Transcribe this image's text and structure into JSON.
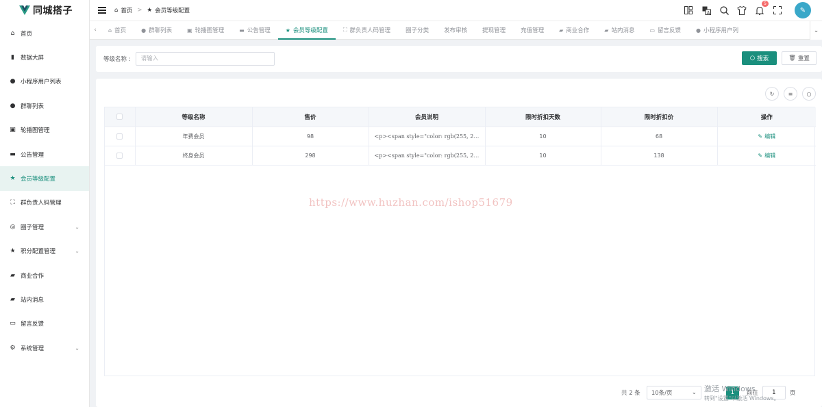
{
  "app": {
    "title": "同城搭子"
  },
  "sidebar": {
    "items": [
      {
        "label": "首页",
        "icon": "home-icon",
        "glyph": "⌂",
        "active": false,
        "expandable": false
      },
      {
        "label": "数据大屏",
        "icon": "bar-chart-icon",
        "glyph": "▮",
        "active": false,
        "expandable": false
      },
      {
        "label": "小程序用户列表",
        "icon": "user-icon",
        "glyph": "●",
        "active": false,
        "expandable": false
      },
      {
        "label": "群聊列表",
        "icon": "user-icon",
        "glyph": "●",
        "active": false,
        "expandable": false
      },
      {
        "label": "轮播图管理",
        "icon": "image-icon",
        "glyph": "▣",
        "active": false,
        "expandable": false
      },
      {
        "label": "公告管理",
        "icon": "message-icon",
        "glyph": "▬",
        "active": false,
        "expandable": false
      },
      {
        "label": "会员等级配置",
        "icon": "star-icon",
        "glyph": "★",
        "active": true,
        "expandable": false
      },
      {
        "label": "群负责人码管理",
        "icon": "scan-icon",
        "glyph": "⛶",
        "active": false,
        "expandable": false
      },
      {
        "label": "圈子管理",
        "icon": "circles-icon",
        "glyph": "◎",
        "active": false,
        "expandable": true
      },
      {
        "label": "积分配置管理",
        "icon": "star-icon",
        "glyph": "★",
        "active": false,
        "expandable": true
      },
      {
        "label": "商业合作",
        "icon": "briefcase-icon",
        "glyph": "▰",
        "active": false,
        "expandable": false
      },
      {
        "label": "站内消息",
        "icon": "inbox-icon",
        "glyph": "▰",
        "active": false,
        "expandable": false
      },
      {
        "label": "留言反馈",
        "icon": "comment-icon",
        "glyph": "▭",
        "active": false,
        "expandable": false
      },
      {
        "label": "系统管理",
        "icon": "gear-icon",
        "glyph": "⚙",
        "active": false,
        "expandable": true
      }
    ]
  },
  "header": {
    "breadcrumb": [
      {
        "label": "首页",
        "icon": "home-icon"
      },
      {
        "label": "会员等级配置",
        "icon": "star-icon"
      }
    ],
    "notifications_count": "5"
  },
  "tabs": [
    {
      "label": "首页",
      "icon": "home-icon",
      "glyph": "⌂",
      "active": false
    },
    {
      "label": "群聊列表",
      "icon": "user-icon",
      "glyph": "●",
      "active": false
    },
    {
      "label": "轮播图管理",
      "icon": "image-icon",
      "glyph": "▣",
      "active": false
    },
    {
      "label": "公告管理",
      "icon": "message-icon",
      "glyph": "▬",
      "active": false
    },
    {
      "label": "会员等级配置",
      "icon": "star-icon",
      "glyph": "★",
      "active": true
    },
    {
      "label": "群负责人码管理",
      "icon": "scan-icon",
      "glyph": "⛶",
      "active": false
    },
    {
      "label": "圈子分类",
      "icon": "",
      "glyph": "",
      "active": false
    },
    {
      "label": "发布审核",
      "icon": "",
      "glyph": "",
      "active": false
    },
    {
      "label": "提现管理",
      "icon": "",
      "glyph": "",
      "active": false
    },
    {
      "label": "充值管理",
      "icon": "",
      "glyph": "",
      "active": false
    },
    {
      "label": "商业合作",
      "icon": "briefcase-icon",
      "glyph": "▰",
      "active": false
    },
    {
      "label": "站内消息",
      "icon": "inbox-icon",
      "glyph": "▰",
      "active": false
    },
    {
      "label": "留言反馈",
      "icon": "comment-icon",
      "glyph": "▭",
      "active": false
    },
    {
      "label": "小程序用户列",
      "icon": "user-icon",
      "glyph": "●",
      "active": false
    }
  ],
  "search": {
    "label": "等级名称 :",
    "placeholder": "请输入",
    "value": "",
    "search_button": "搜索",
    "reset_button": "重置"
  },
  "table": {
    "columns": [
      "等级名称",
      "售价",
      "会员说明",
      "限时折扣天数",
      "限时折扣价",
      "操作"
    ],
    "rows": [
      {
        "name": "年费会员",
        "price": "98",
        "desc": "<p><span style=\"color: rgb(255, 255, 2...",
        "discount_days": "10",
        "discount_price": "68",
        "action": "编辑"
      },
      {
        "name": "终身会员",
        "price": "298",
        "desc": "<p><span style=\"color: rgb(255, 255, 2...",
        "discount_days": "10",
        "discount_price": "138",
        "action": "编辑"
      }
    ]
  },
  "watermark": "https://www.huzhan.com/ishop51679",
  "pagination": {
    "total": "共 2 条",
    "page_size": "10条/页",
    "current_page": "1",
    "goto_label": "前往",
    "goto_value": "1",
    "page_suffix": "页"
  },
  "os_overlay": {
    "line1": "激活 Windows",
    "line2": "转到\"设置\"以激活 Windows。"
  },
  "colors": {
    "accent": "#1a8f7d",
    "badge": "#f56c6c",
    "background": "#f0f2f5"
  }
}
